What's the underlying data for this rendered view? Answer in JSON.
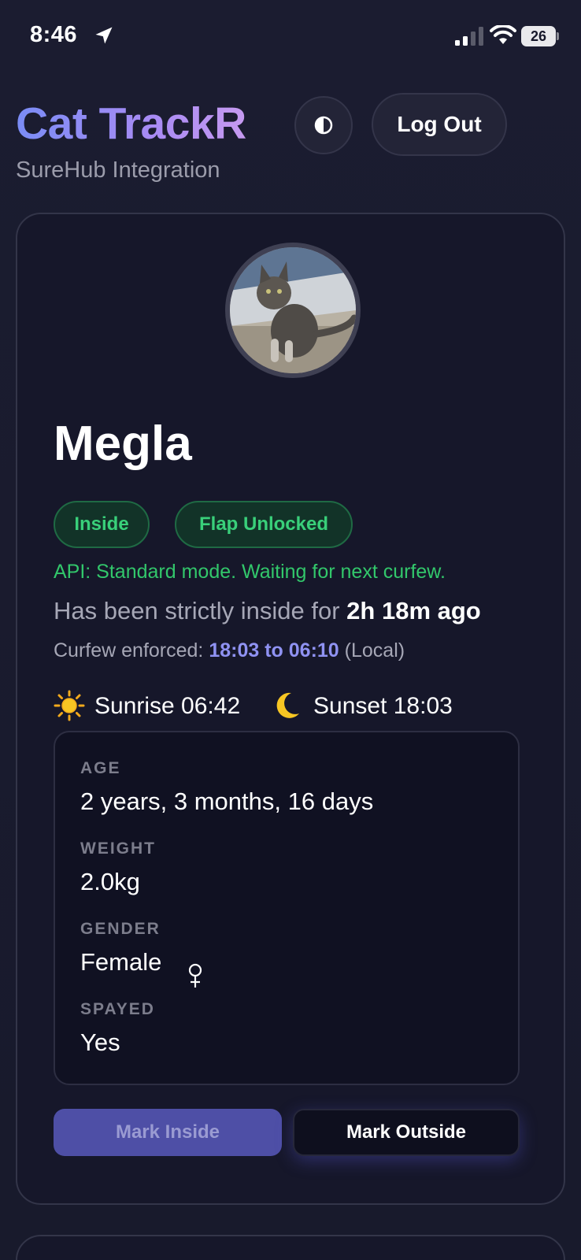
{
  "status_bar": {
    "time": "8:46",
    "battery": "26",
    "icons": [
      "location-arrow-icon",
      "cell-signal-icon",
      "wifi-icon",
      "battery-icon"
    ]
  },
  "header": {
    "title": "Cat TrackR",
    "subtitle": "SureHub Integration",
    "theme_toggle_icon": "contrast-icon",
    "logout_label": "Log Out"
  },
  "cat": {
    "name": "Megla",
    "badges": [
      "Inside",
      "Flap Unlocked"
    ],
    "api_status": "API: Standard mode. Waiting for next curfew.",
    "inside_prefix": "Has been strictly inside for",
    "inside_duration": "2h 18m ago",
    "curfew_prefix": "Curfew enforced:",
    "curfew_window": "18:03 to 06:10",
    "curfew_suffix": "(Local)",
    "sunrise": "Sunrise 06:42",
    "sunset": "Sunset 18:03",
    "details": [
      {
        "label": "AGE",
        "value": "2 years, 3 months, 16 days"
      },
      {
        "label": "WEIGHT",
        "value": "2.0kg"
      },
      {
        "label": "GENDER",
        "value": "Female"
      },
      {
        "label": "SPAYED",
        "value": "Yes"
      }
    ],
    "gender_icon": "female-symbol-icon",
    "actions": {
      "mark_inside": "Mark Inside",
      "mark_outside": "Mark Outside"
    }
  },
  "colors": {
    "background": "#191a2d",
    "title_gradient_start": "#7a8cf5",
    "title_gradient_end": "#c69af0",
    "status_green": "#39d07a",
    "curfew_accent": "#8f92f2",
    "primary_button": "#4e4fa6"
  }
}
